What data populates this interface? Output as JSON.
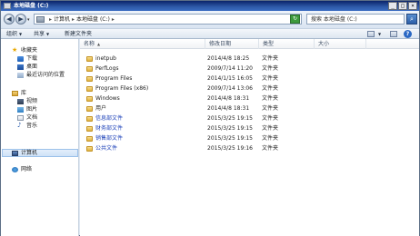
{
  "window": {
    "title": "本地磁盘 (C:)",
    "controls": {
      "minimize": "_",
      "maximize": "□",
      "close": "×"
    }
  },
  "address": {
    "breadcrumb": [
      "计算机",
      "本地磁盘 (C:)"
    ],
    "separator": "▸",
    "back_glyph": "◀",
    "forward_glyph": "▶",
    "dropdown_glyph": "▾",
    "refresh_glyph": "↻",
    "search_placeholder": "搜索 本地磁盘 (C:)",
    "search_glyph": "⌕"
  },
  "toolbar": {
    "organize": "组织",
    "share": "共享",
    "new_folder": "新建文件夹",
    "arrow": "▼",
    "help": "?"
  },
  "sidebar": {
    "favorites": {
      "label": "收藏夹",
      "icon": "star-icon"
    },
    "favorite_items": [
      {
        "label": "下载",
        "icon": "downloads-icon"
      },
      {
        "label": "桌面",
        "icon": "desktop-icon"
      },
      {
        "label": "最近访问的位置",
        "icon": "recent-places-icon"
      }
    ],
    "libraries": {
      "label": "库",
      "icon": "libraries-icon"
    },
    "library_items": [
      {
        "label": "视频",
        "icon": "video-icon"
      },
      {
        "label": "图片",
        "icon": "pictures-icon"
      },
      {
        "label": "文档",
        "icon": "documents-icon"
      },
      {
        "label": "音乐",
        "icon": "music-icon"
      }
    ],
    "computer": {
      "label": "计算机",
      "icon": "computer-icon"
    },
    "network": {
      "label": "网络",
      "icon": "network-icon"
    }
  },
  "columns": {
    "name": "名称",
    "date": "修改日期",
    "type": "类型",
    "size": "大小",
    "sort_glyph": "▲"
  },
  "files": [
    {
      "name": "inetpub",
      "date": "2014/4/8 18:25",
      "type": "文件夹"
    },
    {
      "name": "PerfLogs",
      "date": "2009/7/14 11:20",
      "type": "文件夹"
    },
    {
      "name": "Program Files",
      "date": "2014/1/15 16:05",
      "type": "文件夹"
    },
    {
      "name": "Program Files (x86)",
      "date": "2009/7/14 13:06",
      "type": "文件夹"
    },
    {
      "name": "Windows",
      "date": "2014/4/8 18:31",
      "type": "文件夹"
    },
    {
      "name": "用户",
      "date": "2014/4/8 18:31",
      "type": "文件夹"
    },
    {
      "name": "信息部文件",
      "date": "2015/3/25 19:15",
      "type": "文件夹"
    },
    {
      "name": "财务部文件",
      "date": "2015/3/25 19:15",
      "type": "文件夹"
    },
    {
      "name": "销售部文件",
      "date": "2015/3/25 19:15",
      "type": "文件夹"
    },
    {
      "name": "公共文件",
      "date": "2015/3/25 19:16",
      "type": "文件夹"
    }
  ],
  "colors": {
    "link_blue": "#1a3fb8",
    "folder": "#e0b441",
    "title_bar": "#2f5aa8"
  }
}
